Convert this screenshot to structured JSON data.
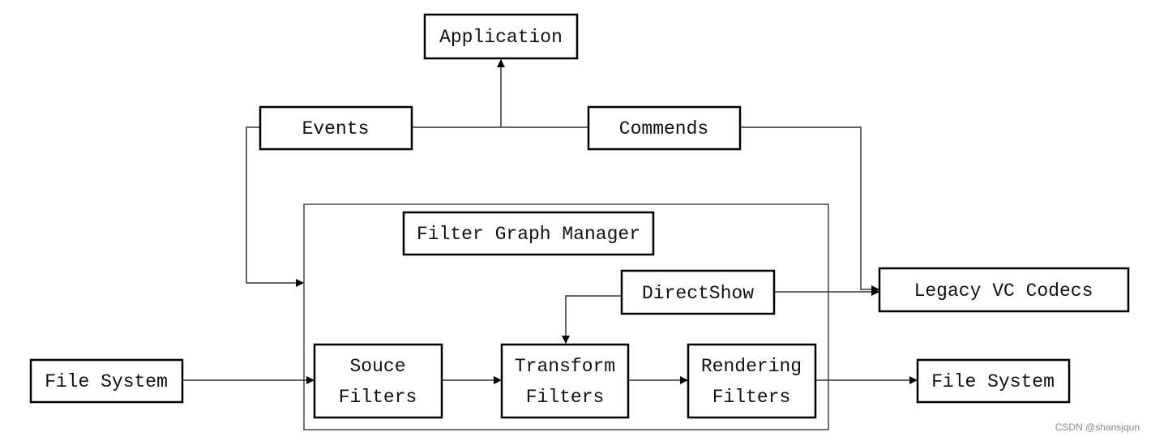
{
  "nodes": {
    "application": "Application",
    "events": "Events",
    "commends": "Commends",
    "filter_graph_manager": "Filter Graph Manager",
    "directshow": "DirectShow",
    "legacy_codecs": "Legacy VC Codecs",
    "file_system_in": "File System",
    "source_filters": [
      "Souce",
      "Filters"
    ],
    "transform_filters": [
      "Transform",
      "Filters"
    ],
    "rendering_filters": [
      "Rendering",
      "Filters"
    ],
    "file_system_out": "File System"
  },
  "watermark": "CSDN @shansjqun"
}
